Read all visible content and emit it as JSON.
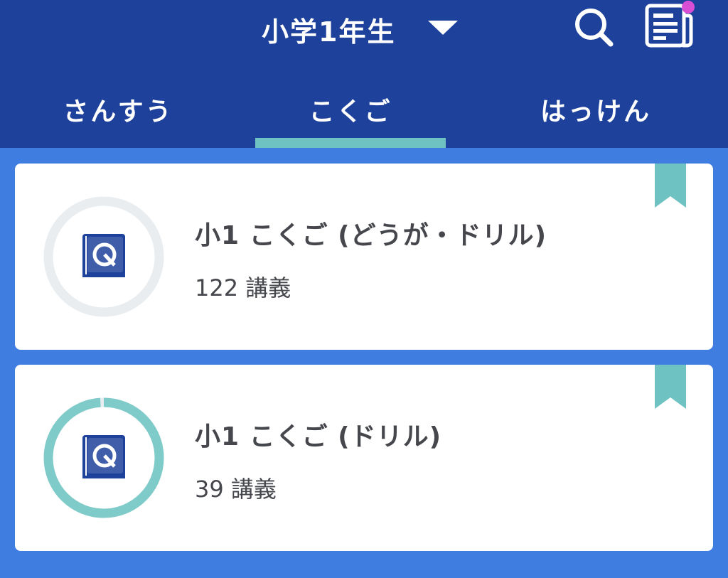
{
  "header": {
    "grade_label": "小学1年生",
    "has_notification": true
  },
  "tabs": [
    {
      "label": "さんすう",
      "selected": false
    },
    {
      "label": "こくご",
      "selected": true
    },
    {
      "label": "はっけん",
      "selected": false
    }
  ],
  "courses": [
    {
      "title": "小1 こくご (どうが・ドリル)",
      "lectures": "122 講義",
      "progress": 0
    },
    {
      "title": "小1 こくご (ドリル)",
      "lectures": "39 講義",
      "progress": 0.99
    }
  ],
  "colors": {
    "header_bg": "#1e419b",
    "page_bg": "#3f7ee0",
    "accent_teal": "#6ec3c2",
    "notification_dot": "#d84fd6",
    "book_blue": "#1e419b",
    "ring_track": "#e9edf0"
  }
}
